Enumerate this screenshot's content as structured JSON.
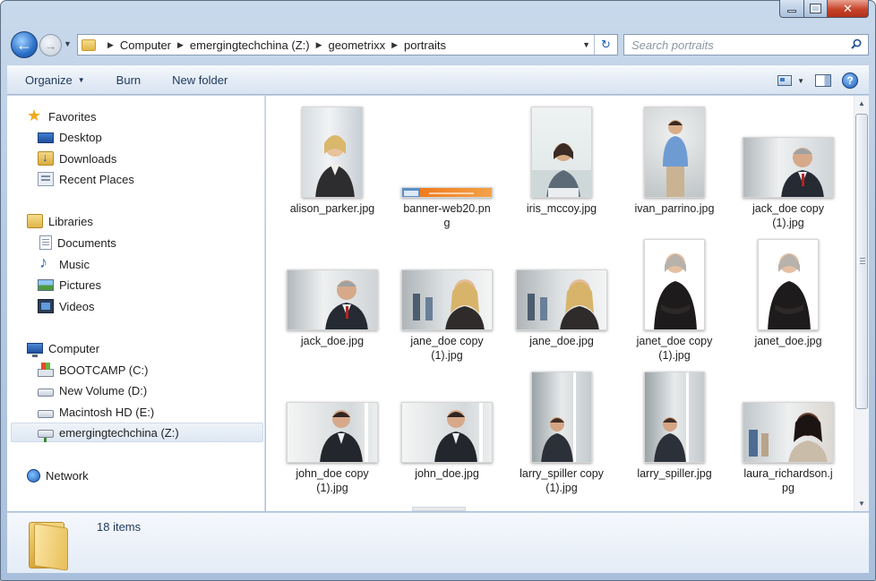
{
  "window": {
    "close_glyph": "✕"
  },
  "address_bar": {
    "crumbs": [
      "Computer",
      "emergingtechchina (Z:)",
      "geometrixx",
      "portraits"
    ]
  },
  "search": {
    "placeholder": "Search portraits"
  },
  "toolbar": {
    "organize_label": "Organize",
    "burn_label": "Burn",
    "new_folder_label": "New folder"
  },
  "nav_pane": {
    "favorites": {
      "label": "Favorites",
      "items": [
        "Desktop",
        "Downloads",
        "Recent Places"
      ]
    },
    "libraries": {
      "label": "Libraries",
      "items": [
        "Documents",
        "Music",
        "Pictures",
        "Videos"
      ]
    },
    "computer": {
      "label": "Computer",
      "items": [
        "BOOTCAMP (C:)",
        "New Volume (D:)",
        "Macintosh HD (E:)",
        "emergingtechchina (Z:)"
      ],
      "selected": "emergingtechchina (Z:)"
    },
    "network": {
      "label": "Network"
    }
  },
  "files": [
    {
      "line1": "alison_parker.jpg",
      "line2": ""
    },
    {
      "line1": "banner-web20.pn",
      "line2": "g"
    },
    {
      "line1": "iris_mccoy.jpg",
      "line2": ""
    },
    {
      "line1": "ivan_parrino.jpg",
      "line2": ""
    },
    {
      "line1": "jack_doe copy",
      "line2": "(1).jpg"
    },
    {
      "line1": "jack_doe.jpg",
      "line2": ""
    },
    {
      "line1": "jane_doe copy",
      "line2": "(1).jpg"
    },
    {
      "line1": "jane_doe.jpg",
      "line2": ""
    },
    {
      "line1": "janet_doe copy",
      "line2": "(1).jpg"
    },
    {
      "line1": "janet_doe.jpg",
      "line2": ""
    },
    {
      "line1": "john_doe copy",
      "line2": "(1).jpg"
    },
    {
      "line1": "john_doe.jpg",
      "line2": ""
    },
    {
      "line1": "larry_spiller copy",
      "line2": "(1).jpg"
    },
    {
      "line1": "larry_spiller.jpg",
      "line2": ""
    },
    {
      "line1": "laura_richardson.j",
      "line2": "pg"
    }
  ],
  "details_pane": {
    "item_count": "18 items"
  },
  "colors": {
    "accent": "#1e395b",
    "selection": "#dfe8f3",
    "frame": "#b7cbe3"
  }
}
